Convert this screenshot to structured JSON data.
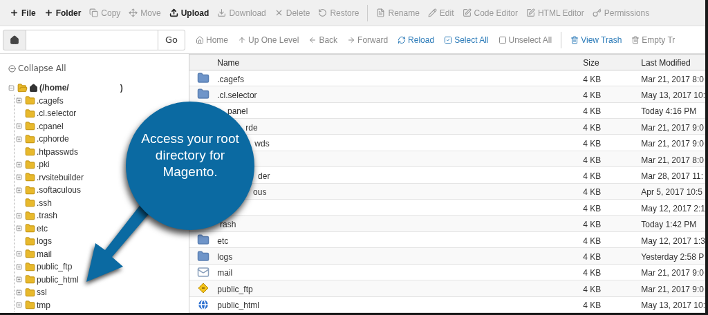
{
  "toolbar": {
    "groups": [
      [
        {
          "label": "File",
          "disabled": false
        },
        {
          "label": "Folder",
          "disabled": false
        },
        {
          "label": "Copy",
          "disabled": true
        },
        {
          "label": "Move",
          "disabled": true
        },
        {
          "label": "Upload",
          "disabled": false
        },
        {
          "label": "Download",
          "disabled": true
        },
        {
          "label": "Delete",
          "disabled": true
        },
        {
          "label": "Restore",
          "disabled": true
        }
      ],
      [
        {
          "label": "Rename",
          "disabled": true
        },
        {
          "label": "Edit",
          "disabled": true
        },
        {
          "label": "Code Editor",
          "disabled": true
        },
        {
          "label": "HTML Editor",
          "disabled": true
        },
        {
          "label": "Permissions",
          "disabled": true
        }
      ]
    ]
  },
  "path_bar": {
    "go": "Go"
  },
  "nav": {
    "groups": [
      [
        {
          "label": "Home",
          "disabled": true
        },
        {
          "label": "Up One Level",
          "disabled": true
        },
        {
          "label": "Back",
          "disabled": true
        },
        {
          "label": "Forward",
          "disabled": true
        },
        {
          "label": "Reload",
          "disabled": false
        },
        {
          "label": "Select All",
          "disabled": false
        },
        {
          "label": "Unselect All",
          "disabled": true
        }
      ],
      [
        {
          "label": "View Trash",
          "disabled": false
        },
        {
          "label": "Empty Tr",
          "disabled": true
        }
      ]
    ]
  },
  "sidebar": {
    "collapse_all": "Collapse All",
    "tree": {
      "label": "(/home/",
      "label_end": ")",
      "expanded": true,
      "children": [
        {
          "label": ".cagefs",
          "expandable": true
        },
        {
          "label": ".cl.selector",
          "expandable": false
        },
        {
          "label": ".cpanel",
          "expandable": true
        },
        {
          "label": ".cphorde",
          "expandable": true
        },
        {
          "label": ".htpasswds",
          "expandable": false
        },
        {
          "label": ".pki",
          "expandable": true
        },
        {
          "label": ".rvsitebuilder",
          "expandable": true
        },
        {
          "label": ".softaculous",
          "expandable": true
        },
        {
          "label": ".ssh",
          "expandable": false
        },
        {
          "label": ".trash",
          "expandable": true
        },
        {
          "label": "etc",
          "expandable": true
        },
        {
          "label": "logs",
          "expandable": false
        },
        {
          "label": "mail",
          "expandable": true
        },
        {
          "label": "public_ftp",
          "expandable": true
        },
        {
          "label": "public_html",
          "expandable": true
        },
        {
          "label": "ssl",
          "expandable": true
        },
        {
          "label": "tmp",
          "expandable": true
        }
      ]
    }
  },
  "table": {
    "columns": [
      "Name",
      "Size",
      "Last Modified"
    ],
    "rows": [
      {
        "kind": "folder",
        "name": ".cagefs",
        "size": "4 KB",
        "modified": "Mar 21, 2017 8:0"
      },
      {
        "kind": "folder",
        "name": ".cl.selector",
        "size": "4 KB",
        "modified": "May 13, 2017 10:"
      },
      {
        "name": "panel",
        "size": "4 KB",
        "modified": "Today 4:16 PM"
      },
      {
        "name": "rde",
        "size": "4 KB",
        "modified": "Mar 21, 2017 9:0"
      },
      {
        "name": "wds",
        "size": "4 KB",
        "modified": "Mar 21, 2017 9:0"
      },
      {
        "size": "4 KB",
        "modified": "Mar 21, 2017 8:0"
      },
      {
        "name": "der",
        "size": "4 KB",
        "modified": "Mar 28, 2017 11:"
      },
      {
        "name": "ous",
        "size": "4 KB",
        "modified": "Apr 5, 2017 10:5"
      },
      {
        "size": "4 KB",
        "modified": "May 12, 2017 2:1"
      },
      {
        "name": "rash",
        "size": "4 KB",
        "modified": "Today 1:42 PM"
      },
      {
        "kind": "folder",
        "name": "etc",
        "size": "4 KB",
        "modified": "May 12, 2017 1:3"
      },
      {
        "kind": "folder",
        "name": "logs",
        "size": "4 KB",
        "modified": "Yesterday 2:58 P"
      },
      {
        "kind": "mail",
        "name": "mail",
        "size": "4 KB",
        "modified": "Mar 21, 2017 9:0"
      },
      {
        "kind": "ftp",
        "name": "public_ftp",
        "size": "4 KB",
        "modified": "Mar 21, 2017 9:0"
      },
      {
        "kind": "web",
        "name": "public_html",
        "size": "4 KB",
        "modified": "May 13, 2017 10:"
      }
    ]
  },
  "callout": {
    "text": "Access your root directory for Magento."
  }
}
